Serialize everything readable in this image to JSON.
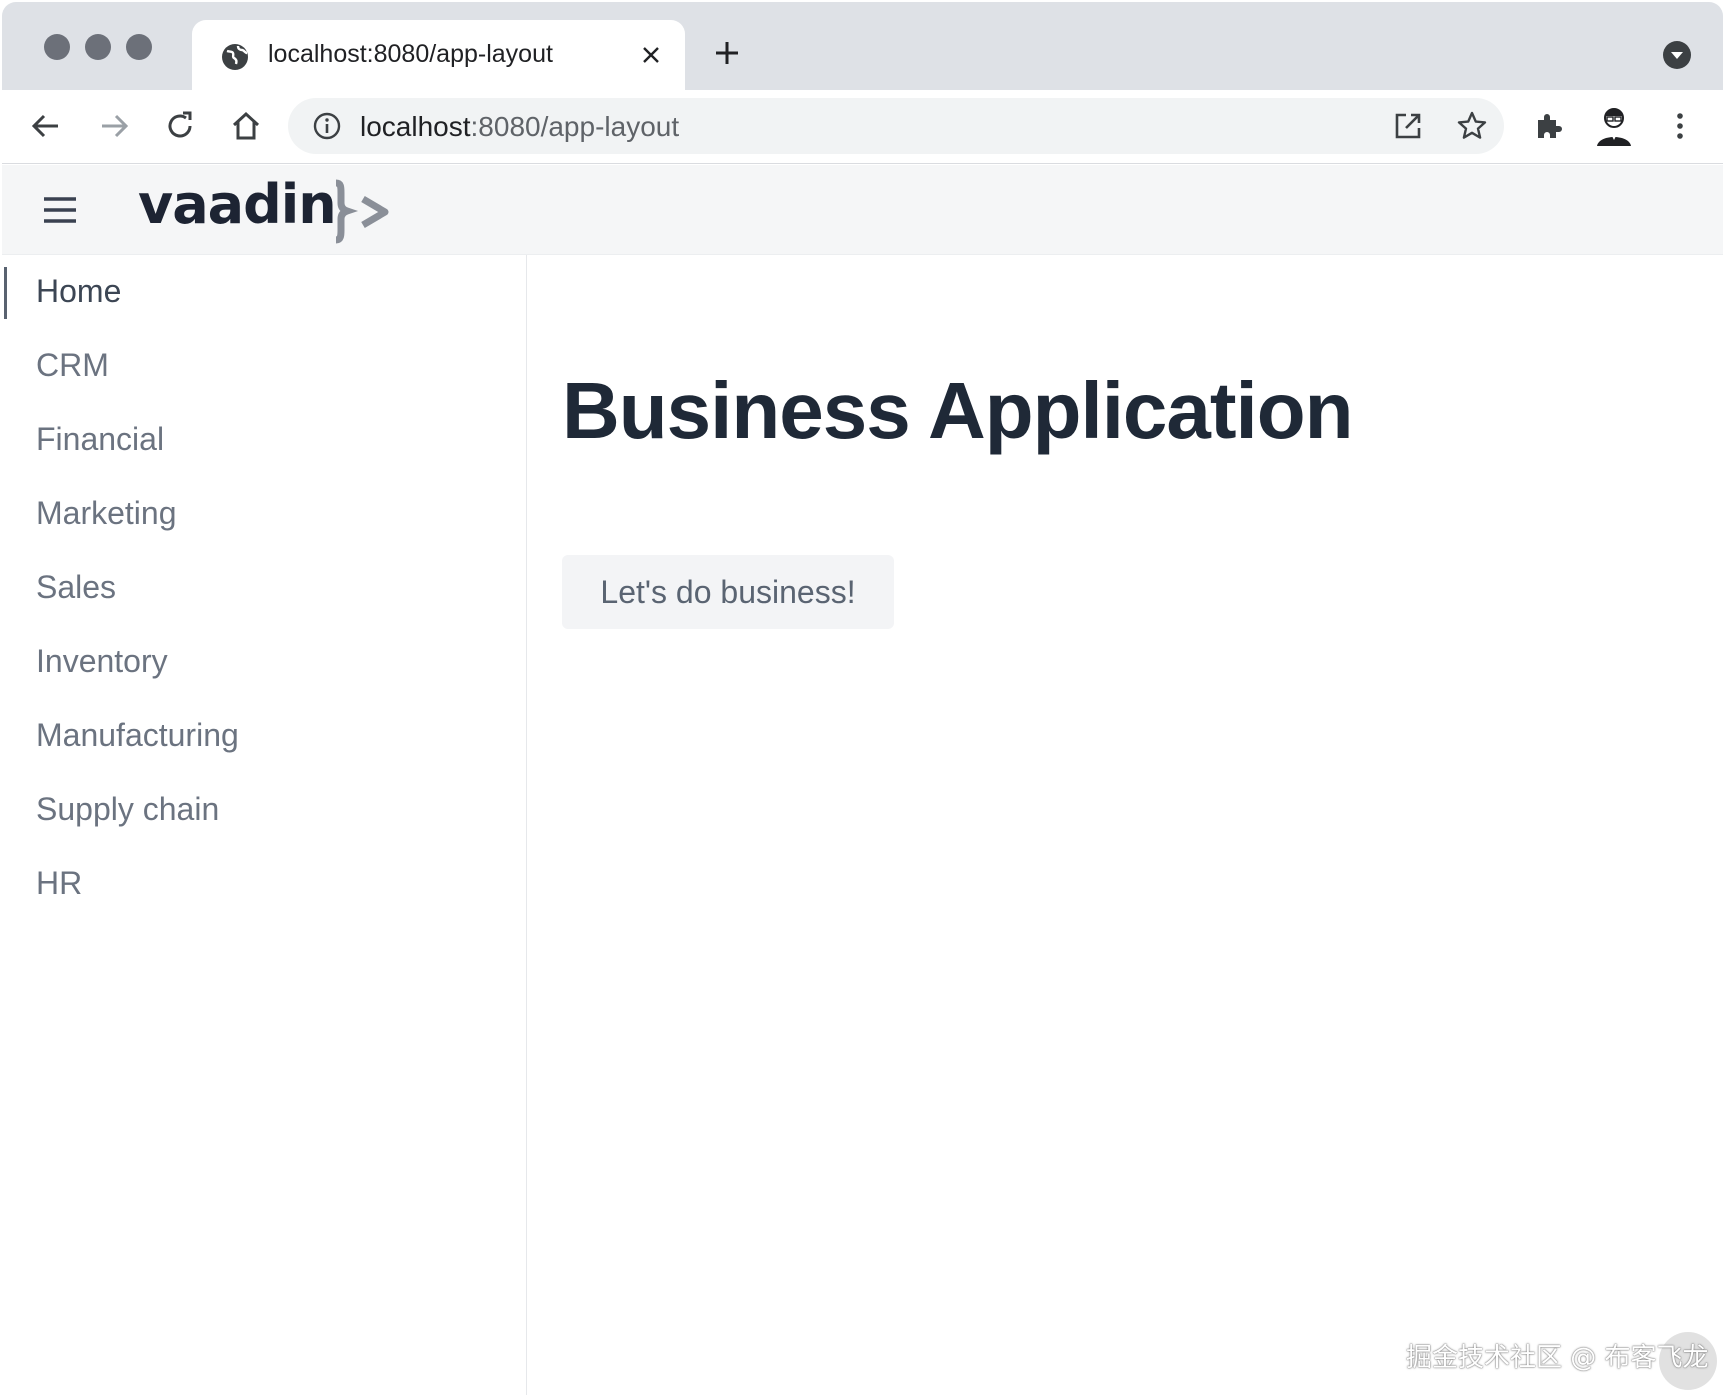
{
  "browser": {
    "tab_title": "localhost:8080/app-layout",
    "url_host": "localhost",
    "url_path": ":8080/app-layout"
  },
  "app": {
    "logo_text": "vaadin",
    "nav_items": [
      {
        "label": "Home",
        "active": true
      },
      {
        "label": "CRM"
      },
      {
        "label": "Financial"
      },
      {
        "label": "Marketing"
      },
      {
        "label": "Sales"
      },
      {
        "label": "Inventory"
      },
      {
        "label": "Manufacturing"
      },
      {
        "label": "Supply chain"
      },
      {
        "label": "HR"
      }
    ],
    "page_title": "Business Application",
    "primary_button_label": "Let's do business!"
  },
  "watermark": "掘金技术社区 @ 布客飞龙",
  "icons": [
    "globe-icon",
    "close-icon",
    "plus-icon",
    "tab-search-icon",
    "back-icon",
    "forward-icon",
    "reload-icon",
    "home-icon",
    "info-icon",
    "open-external-icon",
    "star-icon",
    "extensions-icon",
    "profile-avatar",
    "more-vert-icon",
    "hamburger-icon"
  ],
  "colors": {
    "tabstrip": "#dee1e6",
    "navbar_bg": "#f5f6f7",
    "title_text": "#1f2937",
    "nav_text": "#6b7380",
    "button_bg": "#f3f4f6"
  }
}
